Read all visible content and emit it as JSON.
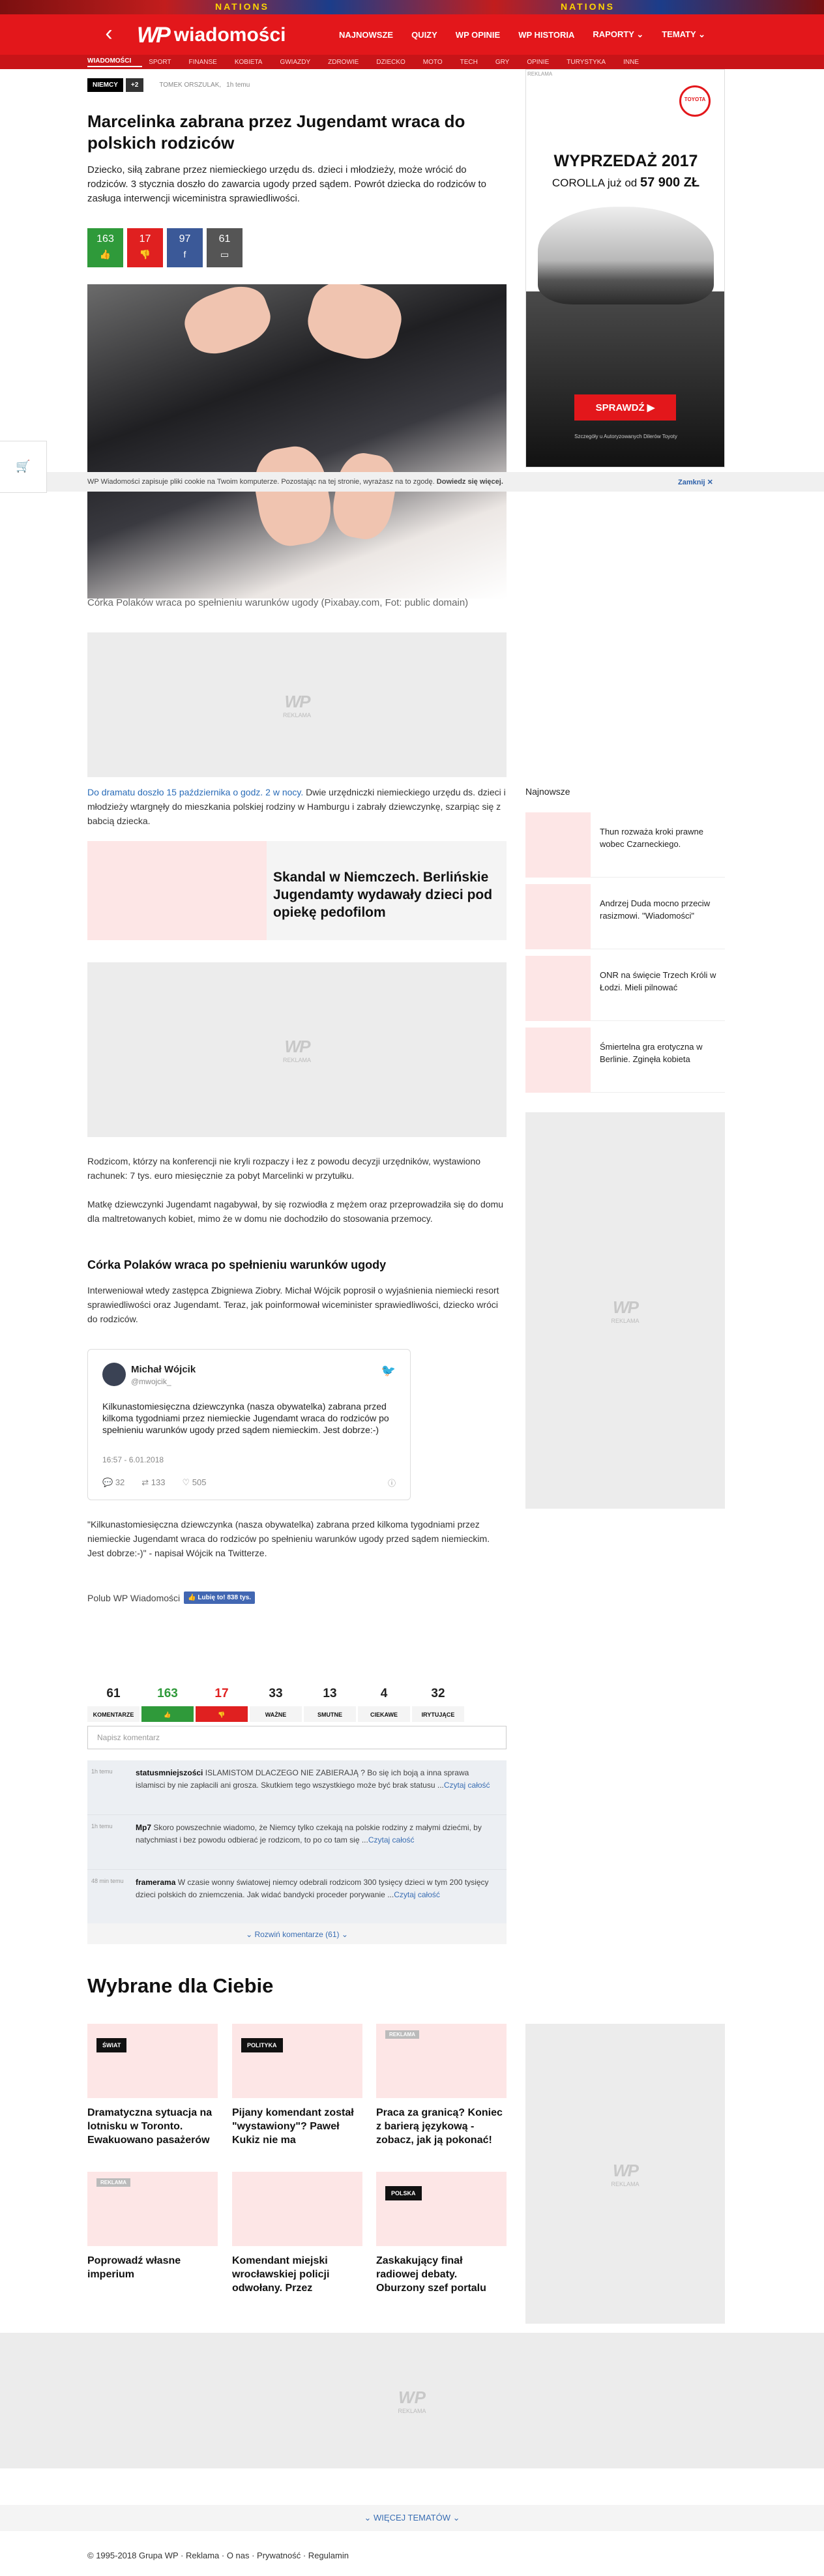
{
  "promo": {
    "left": "NATIONS",
    "right": "NATIONS"
  },
  "header": {
    "logo_wp": "WP",
    "logo_text": "wiadomości",
    "nav": [
      "NAJNOWSZE",
      "QUIZY",
      "WP OPINIE",
      "WP HISTORIA",
      "RAPORTY ⌄",
      "TEMATY ⌄"
    ]
  },
  "subnav": {
    "items": [
      "WIADOMOŚCI",
      "SPORT",
      "FINANSE",
      "KOBIETA",
      "GWIAZDY",
      "ZDROWIE",
      "DZIECKO",
      "MOTO",
      "TECH",
      "GRY",
      "OPINIE",
      "TURYSTYKA",
      "INNE"
    ]
  },
  "article": {
    "tag": "NIEMCY",
    "tag_more": "+2",
    "author": "TOMEK ORSZULAK,",
    "time": "1h temu",
    "title": "Marcelinka zabrana przez Jugendamt wraca do polskich rodziców",
    "lead": "Dziecko, siłą zabrane przez niemieckiego urzędu ds. dzieci i młodzieży, może wrócić do rodziców. 3 stycznia doszło do zawarcia ugody przed sądem. Powrót dziecka do rodziców to zasługa interwencji wiceministra sprawiedliwości.",
    "votes": {
      "up": "163",
      "down": "17",
      "fb": "97",
      "comments": "61"
    },
    "caption": "Córka Polaków wraca po spełnieniu warunków ugody (Pixabay.com, Fot: public domain)",
    "p1_link": "Do dramatu doszło 15 października o godz. 2 w nocy.",
    "p1": " Dwie urzędniczki niemieckiego urzędu ds. dzieci i młodzieży wtargnęły do mieszkania polskiej rodziny w Hamburgu i zabrały dziewczynkę, szarpiąc się z babcią dziecka.",
    "related": "Skandal w Niemczech. Berlińskie Jugendamty wydawały dzieci pod opiekę pedofilom",
    "p2": "Rodzicom, którzy na konferencji nie kryli rozpaczy i łez z powodu decyzji urzędników, wystawiono rachunek: 7 tys. euro miesięcznie za pobyt Marcelinki w przytułku.",
    "p3": "Matkę dziewczynki Jugendamt nagabywał, by się rozwiodła z mężem oraz przeprowadziła się do domu dla maltretowanych kobiet, mimo że w domu nie dochodziło do stosowania przemocy.",
    "h3": "Córka Polaków wraca po spełnieniu warunków ugody",
    "p4": "Interweniował wtedy zastępca Zbigniewa Ziobry. Michał Wójcik poprosił o wyjaśnienia niemiecki resort sprawiedliwości oraz Jugendamt. Teraz, jak poinformował wiceminister sprawiedliwości, dziecko wróci do rodziców.",
    "tweet": {
      "name": "Michał Wójcik",
      "handle": "@mwojcik_",
      "text": "Kilkunastomiesięczna dziewczynka (nasza obywatelka) zabrana przed kilkoma tygodniami przez niemieckie Jugendamt wraca do rodziców po spełnieniu warunków ugody przed sądem niemieckim. Jest dobrze:-)",
      "date": "16:57 - 6.01.2018",
      "replies": "32",
      "retweets": "133",
      "likes": "505"
    },
    "p5": "\"Kilkunastomiesięczna dziewczynka (nasza obywatelka) zabrana przed kilkoma tygodniami przez niemieckie Jugendamt wraca do rodziców po spełnieniu warunków ugody przed sądem niemieckim. Jest dobrze:-)\" - napisał Wójcik na Twitterze.",
    "fb_label": "Polub WP Wiadomości",
    "fb_btn": "👍 Lubię to! 838 tys."
  },
  "reactions": [
    {
      "n": "61",
      "l": "KOMENTARZE"
    },
    {
      "n": "163",
      "l": "👍"
    },
    {
      "n": "17",
      "l": "👎"
    },
    {
      "n": "33",
      "l": "WAŻNE"
    },
    {
      "n": "13",
      "l": "SMUTNE"
    },
    {
      "n": "4",
      "l": "CIEKAWE"
    },
    {
      "n": "32",
      "l": "IRYTUJĄCE"
    }
  ],
  "comment_placeholder": "Napisz komentarz",
  "comments": [
    {
      "ago": "1h temu",
      "user": "statusmniejszości",
      "text": " ISLAMISTOM DLACZEGO NIE ZABIERAJĄ ? Bo się ich boją a inna sprawa islamisci by nie zapłacili ani grosza. Skutkiem tego wszystkiego może być brak statusu ...",
      "more": "Czytaj całość"
    },
    {
      "ago": "1h temu",
      "user": "Mp7",
      "text": " Skoro powszechnie wiadomo, że Niemcy tylko czekają na polskie rodziny z małymi dziećmi, by natychmiast i bez powodu odbierać je rodzicom, to po co tam się ...",
      "more": "Czytaj całość"
    },
    {
      "ago": "48 min temu",
      "user": "framerama",
      "text": " W czasie wonny światowej niemcy odebrali rodzicom 300 tysięcy dzieci w tym 200 tysięcy dzieci polskich do zniemczenia. Jak widać bandycki proceder porywanie ...",
      "more": "Czytaj całość"
    }
  ],
  "more_comments": "⌄ Rozwiń komentarze (61) ⌄",
  "picks_title": "Wybrane dla Ciebie",
  "picks": [
    {
      "label": "ŚWIAT",
      "title": "Dramatyczna sytuacja na lotnisku w Toronto. Ewakuowano pasażerów"
    },
    {
      "label": "POLITYKA",
      "title": "Pijany komendant został \"wystawiony\"? Paweł Kukiz nie ma"
    },
    {
      "label": "REKLAMA",
      "title": "Praca za granicą? Koniec z barierą językową - zobacz, jak ją pokonać!"
    },
    {
      "label": "REKLAMA",
      "title": "Poprowadź własne imperium"
    },
    {
      "label": "",
      "title": "Komendant miejski wrocławskiej policji odwołany. Przez"
    },
    {
      "label": "POLSKA",
      "title": "Zaskakujący finał radiowej debaty. Oburzony szef portalu"
    }
  ],
  "ad": {
    "label": "REKLAMA",
    "wp": "WP",
    "brand": "TOYOTA",
    "title": "WYPRZEDAŻ 2017",
    "sub": "COROLLA już od",
    "price": "57 900 ZŁ",
    "cta": "SPRAWDŹ ▶",
    "fine": "Szczegóły u Autoryzowanych Dilerów Toyoty"
  },
  "najnowsze": {
    "title": "Najnowsze",
    "items": [
      "Thun rozważa kroki prawne wobec Czarneckiego.",
      "Andrzej Duda mocno przeciw rasizmowi. \"Wiadomości\"",
      "ONR na święcie Trzech Króli w Łodzi. Mieli pilnować",
      "Śmiertelna gra erotyczna w Berlinie. Zginęła kobieta"
    ]
  },
  "cookie": {
    "text": "WP Wiadomości zapisuje pliki cookie na Twoim komputerze. Pozostając na tej stronie, wyrażasz na to zgodę.",
    "more": "Dowiedz się więcej.",
    "close": "Zamknij ✕"
  },
  "more_topics": "⌄ WIĘCEJ TEMATÓW ⌄",
  "footer": "© 1995-2018 Grupa WP  ·  Reklama  ·  O nas  ·  Prywatność  ·  Regulamin"
}
